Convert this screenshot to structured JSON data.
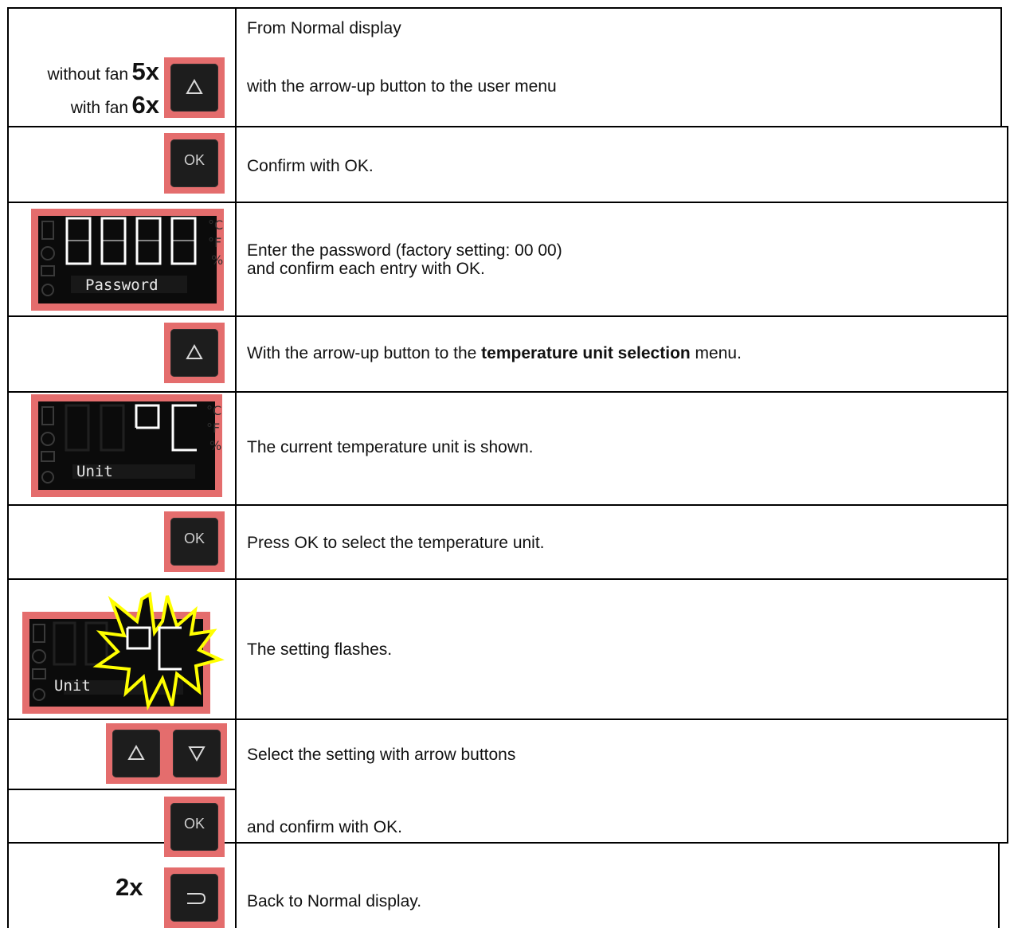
{
  "rows": {
    "r1": {
      "line1": "From Normal display",
      "line2": "with the arrow-up button to the user menu",
      "without_label": "without fan",
      "without_count": "5x",
      "with_label": "with fan",
      "with_count": "6x"
    },
    "r2": {
      "text": "Confirm with OK.",
      "button": "OK"
    },
    "r3": {
      "line1": "Enter the password (factory setting: 00 00)",
      "line2": "and confirm each entry with OK.",
      "display_digits": "0000",
      "display_label": "Password"
    },
    "r4": {
      "pre": "With the arrow-up button to the ",
      "bold": "temperature unit selection",
      "post": " menu."
    },
    "r5": {
      "text": "The current temperature unit is shown.",
      "display_label": "Unit"
    },
    "r6": {
      "text": "Press OK to select the temperature unit.",
      "button": "OK"
    },
    "r7": {
      "text": "The setting flashes.",
      "display_label": "Unit"
    },
    "r8": {
      "text": "Select the setting with arrow buttons"
    },
    "r9": {
      "text": "and confirm with OK.",
      "button": "OK"
    },
    "r10": {
      "count": "2x",
      "text": "Back to Normal display."
    }
  },
  "icons": [
    "arrow-up-icon",
    "arrow-down-icon",
    "back-icon",
    "flash-burst-icon"
  ],
  "colors": {
    "button_frame": "#e46d6d",
    "button_face": "#1d1d1d",
    "flash": "#ffff00"
  }
}
